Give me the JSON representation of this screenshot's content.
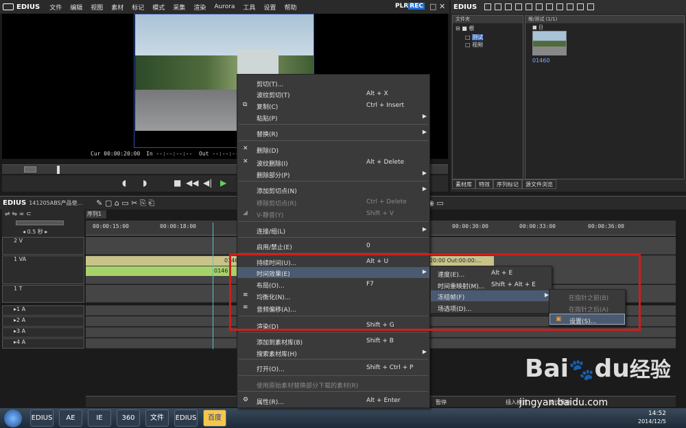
{
  "app": {
    "name": "EDIUS",
    "plr_label": "PLR",
    "rec_label": "REC"
  },
  "menubar": {
    "items": [
      "文件",
      "编辑",
      "视图",
      "素材",
      "标记",
      "模式",
      "采集",
      "渲染",
      "Aurora",
      "工具",
      "设置",
      "帮助"
    ]
  },
  "player": {
    "cur_label": "Cur",
    "cur_value": "00:00:20:00",
    "in_label": "In",
    "in_value": "--:--:--:--",
    "out_label": "Out",
    "out_value": "--:--:--:--"
  },
  "bin": {
    "title": "EDIUS",
    "folder_header": "文件夹",
    "root": "根",
    "folder1": "测试",
    "folder2": "视频",
    "clip_header": "根/测试 (1/1)",
    "clip_name": "日",
    "clip_id": "01460",
    "tabs": [
      "素材库",
      "特效",
      "序列标记",
      "源文件浏览"
    ]
  },
  "timeline": {
    "title": "EDIUS",
    "project": "141205ABS产品使...",
    "seq_tab": "序列1",
    "speed": "0.5 秒",
    "ruler": [
      "00:00:15:00",
      "00:00:18:00",
      "00:00:30:00",
      "00:00:33:00",
      "00:00:36:00"
    ],
    "tracks": {
      "v2": "2 V",
      "va1": "1 VA",
      "t1": "1 T",
      "a1": "1 A",
      "a2": "2 A",
      "a3": "3 A",
      "a4": "4 A"
    },
    "clip_id": "0146",
    "clip_id2": "0146",
    "clip_tail": "20:00 Out:00:00:..."
  },
  "context_menu": [
    {
      "label": "剪切(T)...",
      "shortcut": "",
      "arrow": false,
      "disabled": false
    },
    {
      "label": "波纹剪切(T)",
      "shortcut": "Alt + X",
      "arrow": false,
      "disabled": false
    },
    {
      "label": "复制(C)",
      "shortcut": "Ctrl + Insert",
      "arrow": false,
      "disabled": false
    },
    {
      "label": "粘贴(P)",
      "shortcut": "",
      "arrow": true,
      "disabled": false
    },
    {
      "label": "替换(R)",
      "shortcut": "",
      "arrow": true,
      "disabled": false
    },
    {
      "label": "删除(D)",
      "shortcut": "",
      "arrow": false,
      "disabled": false
    },
    {
      "label": "波纹删除(I)",
      "shortcut": "Alt + Delete",
      "arrow": false,
      "disabled": false
    },
    {
      "label": "删除部分(P)",
      "shortcut": "",
      "arrow": true,
      "disabled": false
    },
    {
      "label": "添加剪切点(N)",
      "shortcut": "",
      "arrow": true,
      "disabled": false
    },
    {
      "label": "移除剪切点(R)",
      "shortcut": "Ctrl + Delete",
      "arrow": false,
      "disabled": true
    },
    {
      "label": "V-静音(Y)",
      "shortcut": "Shift + V",
      "arrow": false,
      "disabled": true
    },
    {
      "label": "连接/组(L)",
      "shortcut": "",
      "arrow": true,
      "disabled": false
    },
    {
      "label": "启用/禁止(E)",
      "shortcut": "0",
      "arrow": false,
      "disabled": false
    },
    {
      "label": "持续时间(U)...",
      "shortcut": "Alt + U",
      "arrow": false,
      "disabled": false
    },
    {
      "label": "时间效果(E)",
      "shortcut": "",
      "arrow": true,
      "disabled": false
    },
    {
      "label": "布局(O)...",
      "shortcut": "F7",
      "arrow": false,
      "disabled": false
    },
    {
      "label": "均衡化(N)...",
      "shortcut": "",
      "arrow": false,
      "disabled": false
    },
    {
      "label": "音频偏移(A)...",
      "shortcut": "",
      "arrow": false,
      "disabled": false
    },
    {
      "label": "渲染(D)",
      "shortcut": "Shift + G",
      "arrow": false,
      "disabled": false
    },
    {
      "label": "添加到素材库(B)",
      "shortcut": "Shift + B",
      "arrow": false,
      "disabled": false
    },
    {
      "label": "搜索素材库(H)",
      "shortcut": "",
      "arrow": true,
      "disabled": false
    },
    {
      "label": "打开(O)...",
      "shortcut": "Shift + Ctrl + P",
      "arrow": false,
      "disabled": false
    },
    {
      "label": "使用原始素材替换部分下载的素材(R)",
      "shortcut": "",
      "arrow": false,
      "disabled": true
    },
    {
      "label": "属性(R)...",
      "shortcut": "Alt + Enter",
      "arrow": false,
      "disabled": false
    }
  ],
  "submenu1": [
    {
      "label": "速度(E)...",
      "shortcut": "Alt + E"
    },
    {
      "label": "时间重映射(M)...",
      "shortcut": "Shift + Alt + E"
    },
    {
      "label": "冻结帧(F)",
      "shortcut": ""
    },
    {
      "label": "场选项(D)...",
      "shortcut": ""
    }
  ],
  "submenu2": [
    {
      "label": "在指针之前(B)",
      "disabled": true
    },
    {
      "label": "在指针之后(A)",
      "disabled": true
    },
    {
      "label": "设置(S)...",
      "disabled": false
    }
  ],
  "status": {
    "pause": "暂停",
    "insert_mode": "插入模式",
    "ripple": "波纹开启"
  },
  "taskbar": {
    "apps": [
      "EDIUS",
      "AE",
      "IE",
      "360",
      "文件",
      "EDIUS",
      "百度"
    ],
    "time": "14:52",
    "date": "2014/12/5"
  },
  "watermark": {
    "baidu": "Bai",
    "du": "du",
    "jingyan": "经验",
    "url": "jingyan.baidu.com"
  },
  "colors": {
    "highlight": "#4a5a70",
    "redbox": "#d21c1c",
    "clip_video": "#c9c38a",
    "clip_audio": "#a6d26a",
    "playhead": "#5ec1c1",
    "rec": "#1e6fd0"
  }
}
